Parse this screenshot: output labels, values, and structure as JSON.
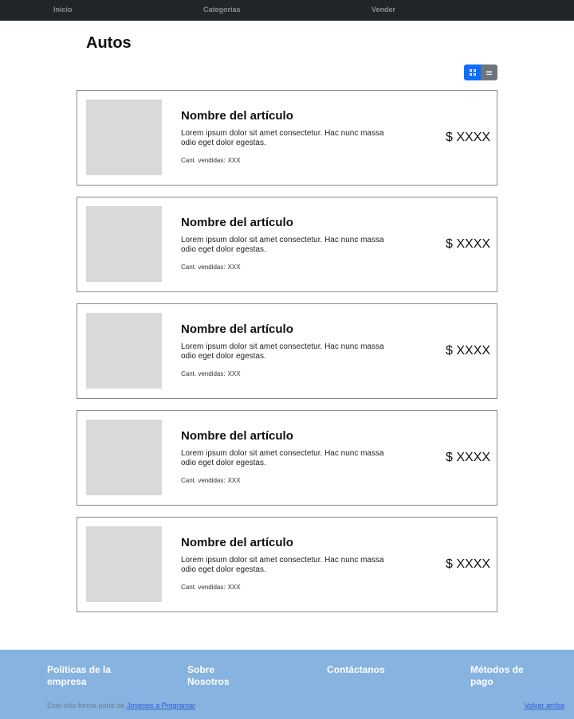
{
  "nav": {
    "items": [
      {
        "label": "Inicio"
      },
      {
        "label": "Categorías"
      },
      {
        "label": "Vender"
      }
    ]
  },
  "page": {
    "title": "Autos"
  },
  "view_toggle": {
    "active": "grid"
  },
  "products": [
    {
      "name": "Nombre del artículo",
      "description": "Lorem ipsum dolor sit amet consectetur. Hac nunc massa odio eget dolor egestas.",
      "sold_label": "Cant. vendidas:",
      "sold_value": "XXX",
      "price": "$ XXXX"
    },
    {
      "name": "Nombre del artículo",
      "description": "Lorem ipsum dolor sit amet consectetur. Hac nunc massa odio eget dolor egestas.",
      "sold_label": "Cant. vendidas:",
      "sold_value": "XXX",
      "price": "$ XXXX"
    },
    {
      "name": "Nombre del artículo",
      "description": "Lorem ipsum dolor sit amet consectetur. Hac nunc massa odio eget dolor egestas.",
      "sold_label": "Cant. vendidas:",
      "sold_value": "XXX",
      "price": "$ XXXX"
    },
    {
      "name": "Nombre del artículo",
      "description": "Lorem ipsum dolor sit amet consectetur. Hac nunc massa odio eget dolor egestas.",
      "sold_label": "Cant. vendidas:",
      "sold_value": "XXX",
      "price": "$ XXXX"
    },
    {
      "name": "Nombre del artículo",
      "description": "Lorem ipsum dolor sit amet consectetur. Hac nunc massa odio eget dolor egestas.",
      "sold_label": "Cant. vendidas:",
      "sold_value": "XXX",
      "price": "$ XXXX"
    }
  ],
  "footer": {
    "columns": [
      {
        "label": "Políticas de la empresa"
      },
      {
        "label": "Sobre Nosotros"
      },
      {
        "label": "Contáctanos"
      },
      {
        "label": "Métodos de pago"
      }
    ],
    "credit_text": "Este sitio forma parte de",
    "credit_link": "Jovenes a Programar",
    "back_to_top": "Volver arriba"
  },
  "colors": {
    "navbar": "#212529",
    "accent": "#0d6efd",
    "secondary": "#6c757d",
    "footer": "#86b3e0",
    "placeholder": "#d9d9d9"
  }
}
